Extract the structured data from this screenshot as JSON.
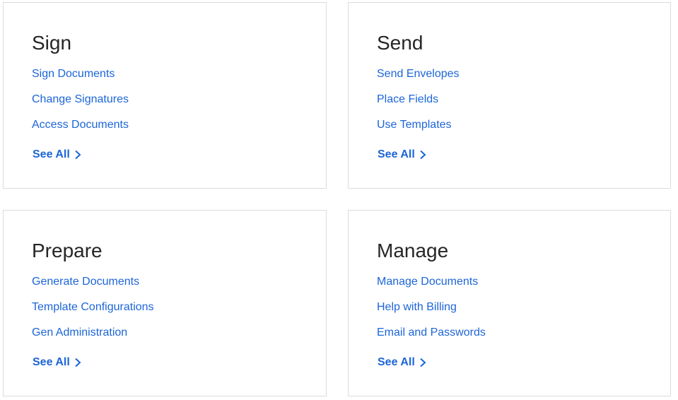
{
  "cards": [
    {
      "title": "Sign",
      "links": [
        "Sign Documents",
        "Change Signatures",
        "Access Documents"
      ],
      "see_all": "See All"
    },
    {
      "title": "Send",
      "links": [
        "Send Envelopes",
        "Place Fields",
        "Use Templates"
      ],
      "see_all": "See All"
    },
    {
      "title": "Prepare",
      "links": [
        "Generate Documents",
        "Template Configurations",
        "Gen Administration"
      ],
      "see_all": "See All"
    },
    {
      "title": "Manage",
      "links": [
        "Manage Documents",
        "Help with Billing",
        "Email and Passwords"
      ],
      "see_all": "See All"
    }
  ],
  "icons": {
    "see_all_arrow": "chevron-right-icon"
  },
  "colors": {
    "link": "#1c65d8",
    "title": "#262626",
    "border": "#dcdcdc"
  }
}
